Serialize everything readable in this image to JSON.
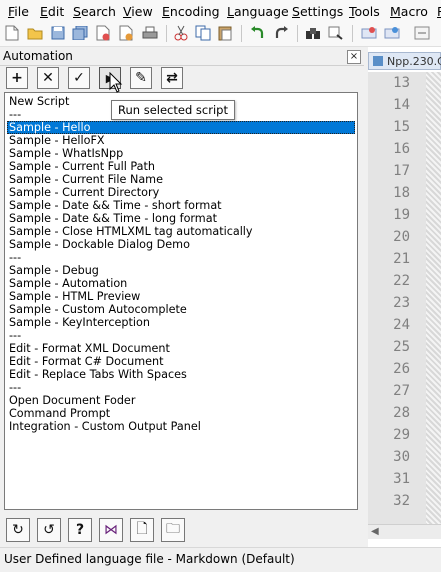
{
  "menu": {
    "items": [
      "File",
      "Edit",
      "Search",
      "View",
      "Encoding",
      "Language",
      "Settings",
      "Tools",
      "Macro",
      "R"
    ]
  },
  "panel": {
    "title": "Automation",
    "close_glyph": "×",
    "toolbar_buttons": [
      {
        "name": "add-icon",
        "glyph": "+"
      },
      {
        "name": "delete-icon",
        "glyph": "✕"
      },
      {
        "name": "checkmark-icon",
        "glyph": "✓"
      },
      {
        "name": "play-icon",
        "glyph": "▶"
      },
      {
        "name": "pencil-icon",
        "glyph": "✎"
      },
      {
        "name": "refresh-icon",
        "glyph": "⇄"
      }
    ],
    "tooltip": "Run selected script",
    "scripts": [
      "New Script",
      "---",
      "Sample - Hello",
      "Sample - HelloFX",
      "Sample - WhatIsNpp",
      "Sample - Current Full Path",
      "Sample - Current File Name",
      "Sample - Current Directory",
      "Sample - Date && Time - short format",
      "Sample - Date && Time - long format",
      "Sample - Close HTMLXML tag automatically",
      "Sample - Dockable Dialog Demo",
      "---",
      "Sample - Debug",
      "Sample - Automation",
      "Sample - HTML Preview",
      "Sample - Custom Autocomplete",
      "Sample - KeyInterception",
      "---",
      "Edit - Format XML Document",
      "Edit - Format C# Document",
      "Edit - Replace Tabs With Spaces",
      "---",
      "Open Document Foder",
      "Command Prompt",
      "Integration - Custom Output Panel"
    ],
    "selected_index": 2,
    "bottom_buttons": [
      {
        "name": "reload-icon",
        "glyph": "↻"
      },
      {
        "name": "undo-icon",
        "glyph": "↺"
      },
      {
        "name": "help-icon",
        "glyph": "?"
      },
      {
        "name": "visual-studio-icon",
        "glyph": "⋈"
      },
      {
        "name": "document-icon",
        "glyph": "🗋"
      },
      {
        "name": "folder-icon",
        "glyph": "🗀"
      }
    ]
  },
  "editor": {
    "tab_label": "Npp.230.C",
    "line_numbers": [
      "13",
      "14",
      "15",
      "16",
      "17",
      "18",
      "19",
      "20",
      "21",
      "22",
      "23",
      "24",
      "25",
      "26",
      "27",
      "28",
      "29",
      "30",
      "31",
      "32"
    ]
  },
  "status": {
    "text": "User Defined language file - Markdown (Default)"
  }
}
